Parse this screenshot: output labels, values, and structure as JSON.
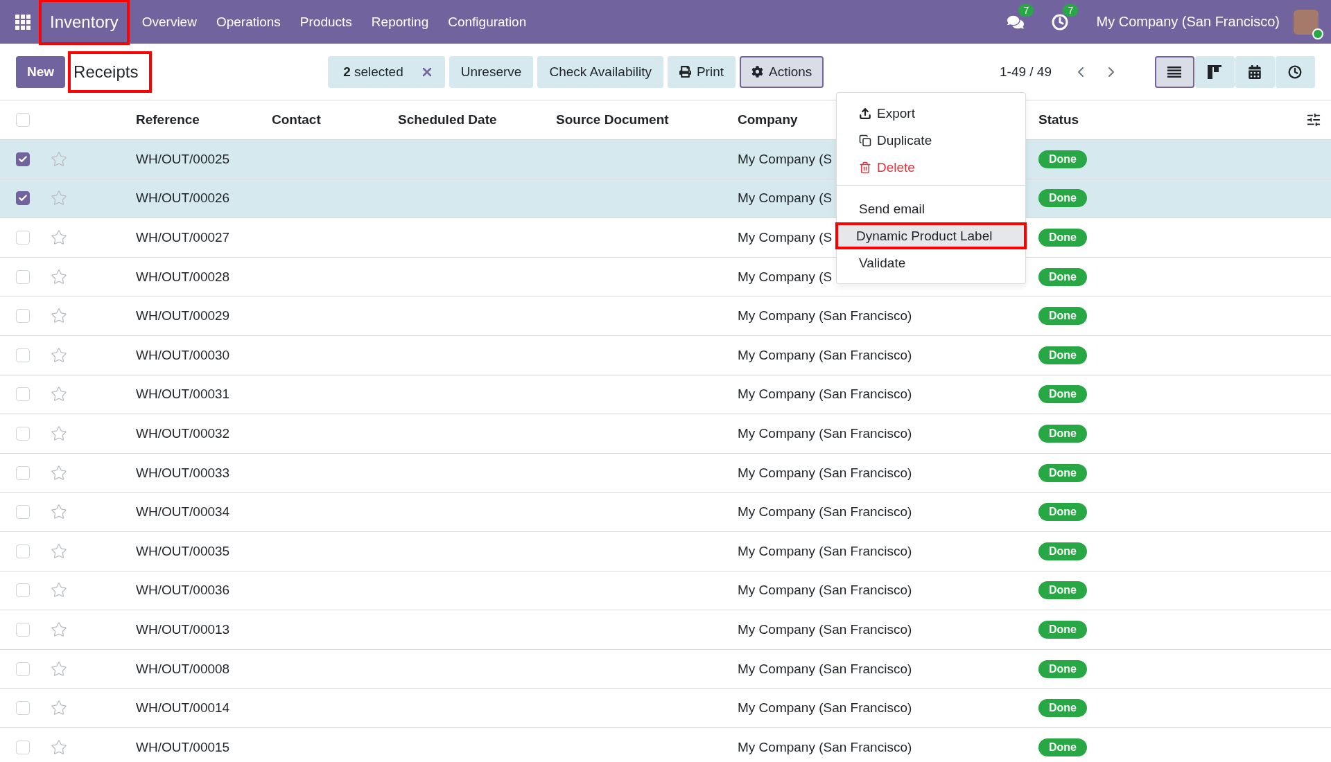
{
  "navbar": {
    "app": {
      "label": "Inventory",
      "highlighted": true
    },
    "menu": [
      "Overview",
      "Operations",
      "Products",
      "Reporting",
      "Configuration"
    ],
    "notifications": [
      {
        "kind": "messages",
        "count": "7"
      },
      {
        "kind": "activities",
        "count": "7"
      }
    ],
    "company": "My Company (San Francisco)"
  },
  "control_panel": {
    "new_button": "New",
    "title": {
      "label": "Receipts",
      "highlighted": true
    },
    "selection": "**2** selected",
    "buttons": [
      {
        "label": "Unreserve",
        "kind": "text",
        "active": false
      },
      {
        "label": "Check Availability",
        "kind": "text",
        "active": false
      },
      {
        "label": "Print",
        "kind": "print",
        "active": false
      },
      {
        "label": "Actions",
        "kind": "actions",
        "active": true
      }
    ],
    "pager": "1-49 / 49",
    "views": [
      {
        "kind": "list",
        "selected": true
      },
      {
        "kind": "kanban",
        "selected": false
      },
      {
        "kind": "calendar",
        "selected": false
      },
      {
        "kind": "activity",
        "selected": false
      }
    ]
  },
  "actions_menu": {
    "sections": [
      {
        "items": [
          {
            "label": "Export",
            "kind": "export",
            "highlighted": false
          },
          {
            "label": "Duplicate",
            "kind": "duplicate",
            "highlighted": false
          },
          {
            "label": "Delete",
            "kind": "delete",
            "highlighted": false
          }
        ]
      },
      {
        "items": [
          {
            "label": "Send email",
            "kind": "plain",
            "highlighted": false
          },
          {
            "label": "Dynamic Product Label",
            "kind": "plain",
            "highlighted": true
          },
          {
            "label": "Validate",
            "kind": "plain",
            "highlighted": false
          }
        ]
      }
    ]
  },
  "table": {
    "select_all": {
      "checked": false
    },
    "columns": [
      "Reference",
      "Contact",
      "Scheduled Date",
      "Source Document",
      "Company",
      "Status"
    ],
    "rows": [
      {
        "reference": "WH/OUT/00025",
        "company": "My Company (S",
        "status": "Done",
        "selected": true
      },
      {
        "reference": "WH/OUT/00026",
        "company": "My Company (S",
        "status": "Done",
        "selected": true
      },
      {
        "reference": "WH/OUT/00027",
        "company": "My Company (S",
        "status": "Done",
        "selected": false
      },
      {
        "reference": "WH/OUT/00028",
        "company": "My Company (S",
        "status": "Done",
        "selected": false
      },
      {
        "reference": "WH/OUT/00029",
        "company": "My Company (San Francisco)",
        "status": "Done",
        "selected": false
      },
      {
        "reference": "WH/OUT/00030",
        "company": "My Company (San Francisco)",
        "status": "Done",
        "selected": false
      },
      {
        "reference": "WH/OUT/00031",
        "company": "My Company (San Francisco)",
        "status": "Done",
        "selected": false
      },
      {
        "reference": "WH/OUT/00032",
        "company": "My Company (San Francisco)",
        "status": "Done",
        "selected": false
      },
      {
        "reference": "WH/OUT/00033",
        "company": "My Company (San Francisco)",
        "status": "Done",
        "selected": false
      },
      {
        "reference": "WH/OUT/00034",
        "company": "My Company (San Francisco)",
        "status": "Done",
        "selected": false
      },
      {
        "reference": "WH/OUT/00035",
        "company": "My Company (San Francisco)",
        "status": "Done",
        "selected": false
      },
      {
        "reference": "WH/OUT/00036",
        "company": "My Company (San Francisco)",
        "status": "Done",
        "selected": false
      },
      {
        "reference": "WH/OUT/00013",
        "company": "My Company (San Francisco)",
        "status": "Done",
        "selected": false
      },
      {
        "reference": "WH/OUT/00008",
        "company": "My Company (San Francisco)",
        "status": "Done",
        "selected": false
      },
      {
        "reference": "WH/OUT/00014",
        "company": "My Company (San Francisco)",
        "status": "Done",
        "selected": false
      },
      {
        "reference": "WH/OUT/00015",
        "company": "My Company (San Francisco)",
        "status": "Done",
        "selected": false
      }
    ]
  }
}
